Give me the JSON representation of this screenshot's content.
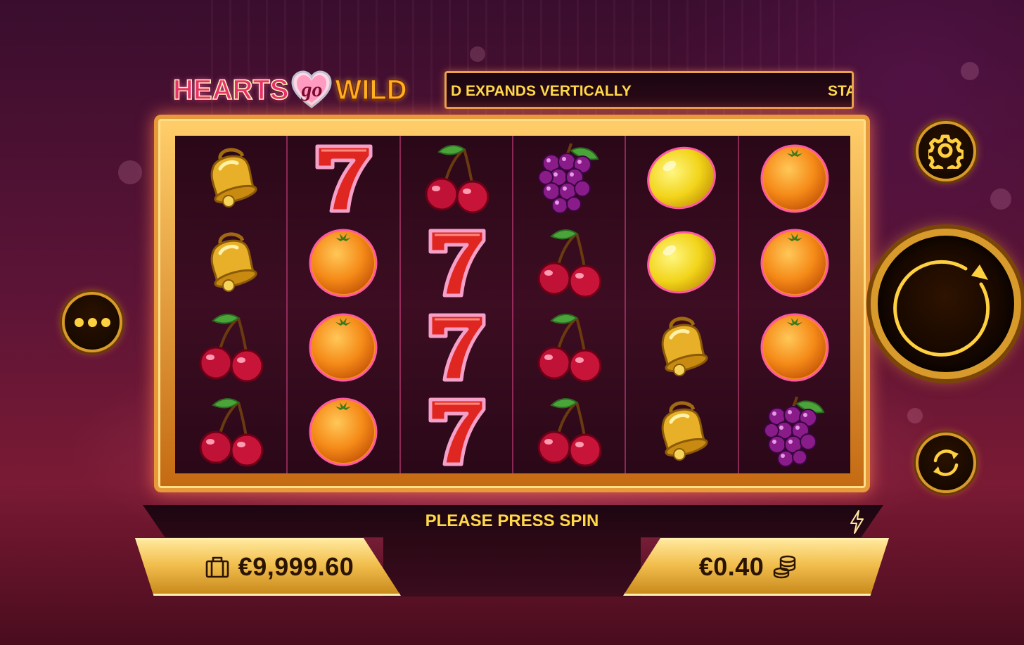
{
  "game": {
    "logo": {
      "word1": "HEARTS",
      "word2": "go",
      "word3": "WILD"
    }
  },
  "ticker": {
    "text_main": "D EXPANDS VERTICALLY",
    "text_next": "STA"
  },
  "reels": [
    [
      "bell",
      "bell",
      "cherry",
      "cherry"
    ],
    [
      "seven",
      "orange",
      "orange",
      "orange"
    ],
    [
      "cherry",
      "seven",
      "seven",
      "seven"
    ],
    [
      "grapes",
      "cherry",
      "cherry",
      "cherry"
    ],
    [
      "lemon",
      "lemon",
      "bell",
      "bell"
    ],
    [
      "orange",
      "orange",
      "orange",
      "grapes"
    ]
  ],
  "message": {
    "text": "PLEASE PRESS SPIN"
  },
  "balance": {
    "value": "€9,999.60",
    "icon": "wallet-icon"
  },
  "bet": {
    "value": "€0.40",
    "icon": "coins-icon"
  },
  "controls": {
    "menu_icon": "more-dots-icon",
    "settings_icon": "gear-icon",
    "spin_icon": "spin-arrow-icon",
    "autoplay_icon": "autoplay-icon"
  },
  "colors": {
    "accent_gold": "#d89a2a",
    "message_text": "#ffd84a",
    "frame": "#e89a3a"
  }
}
